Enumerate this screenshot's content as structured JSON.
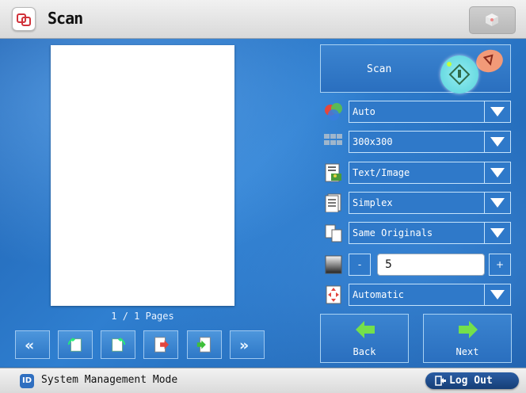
{
  "header": {
    "title": "Scan"
  },
  "preview": {
    "pages_label": "1 / 1 Pages"
  },
  "scan": {
    "label": "Scan"
  },
  "settings": {
    "color_mode": "Auto",
    "resolution": "300x300",
    "original_type": "Text/Image",
    "duplex": "Simplex",
    "original_size": "Same Originals",
    "density_value": "5",
    "density_minus": "-",
    "density_plus": "+",
    "orientation": "Automatic"
  },
  "nav": {
    "back_label": "Back",
    "next_label": "Next",
    "first_icon": "double-left-chevron",
    "last_icon": "double-right-chevron"
  },
  "status": {
    "badge": "ID",
    "mode": "System Management Mode",
    "logout_label": "Log Out"
  },
  "colors": {
    "accent_blue": "#2f79c9",
    "start_cyan": "#58d3dc",
    "stop_orange": "#f29a78",
    "arrow_green": "#74e04b"
  }
}
